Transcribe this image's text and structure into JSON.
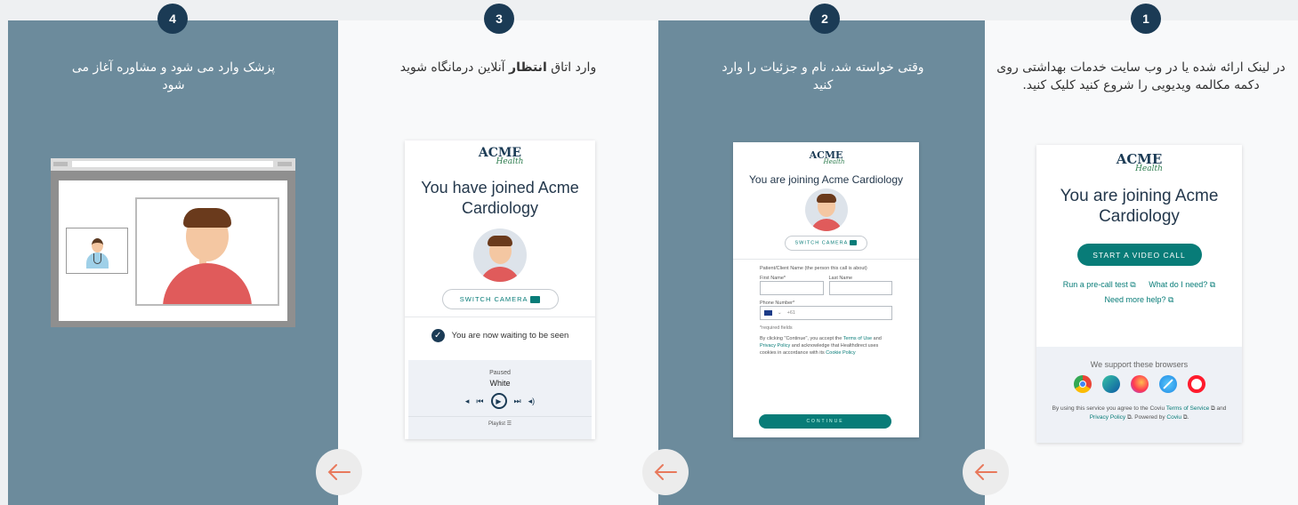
{
  "steps": [
    {
      "number": "1",
      "caption": "در لینک ارائه شده یا در وب سایت خدمات بهداشتی روی دکمه مکالمه ویدیویی را شروع کنید کلیک کنید."
    },
    {
      "number": "2",
      "caption": "وقتی خواسته شد، نام و جزئیات را وارد کنید"
    },
    {
      "number": "3",
      "caption_pre": "وارد اتاق ",
      "caption_bold": "انتظار",
      "caption_post": " آنلاین درمانگاه شوید"
    },
    {
      "number": "4",
      "caption": "پزشک وارد می شود و مشاوره آغاز می شود"
    }
  ],
  "brand": {
    "name": "ACME",
    "sub": "Health"
  },
  "screen1": {
    "title": "You are joining Acme Cardiology",
    "start_button": "START A VIDEO CALL",
    "link_precall": "Run a pre-call test",
    "link_need": "What do I need?",
    "link_help": "Need more help?",
    "browsers_label": "We support these browsers",
    "browsers": [
      "chrome-icon",
      "edge-icon",
      "firefox-icon",
      "safari-icon",
      "opera-icon"
    ],
    "terms_1": "By using this service you agree to the Coviu",
    "terms_link": "Terms of Service",
    "terms_2": "and",
    "privacy_link": "Privacy Policy",
    "powered": ". Powered by",
    "coviu": "Coviu"
  },
  "screen2": {
    "title": "You are joining Acme Cardiology",
    "switch_camera": "SWITCH CAMERA",
    "patient_label": "Patient/Client Name (the person this call is about)",
    "first_name": "First Name*",
    "last_name": "Last Name",
    "phone_label": "Phone Number*",
    "phone_prefix": "+61",
    "required_note": "*required fields",
    "consent_1": "By clicking \"Continue\", you accept the",
    "terms": "Terms of Use",
    "and": "and",
    "privacy": "Privacy Policy",
    "consent_2": "and acknowledge that Healthdirect uses cookies in accordance with its",
    "cookie": "Cookie Policy",
    "continue": "CONTINUE"
  },
  "screen3": {
    "title": "You have joined Acme Cardiology",
    "switch_camera": "SWITCH CAMERA",
    "waiting": "You are now waiting to be seen",
    "player_status": "Paused",
    "track": "White",
    "playlist": "Playlist"
  },
  "colors": {
    "panel_dark": "#6c8b9c",
    "panel_light": "#f8f9fa",
    "badge": "#1b3b55",
    "teal": "#087c78",
    "arrow": "#e8795c"
  }
}
